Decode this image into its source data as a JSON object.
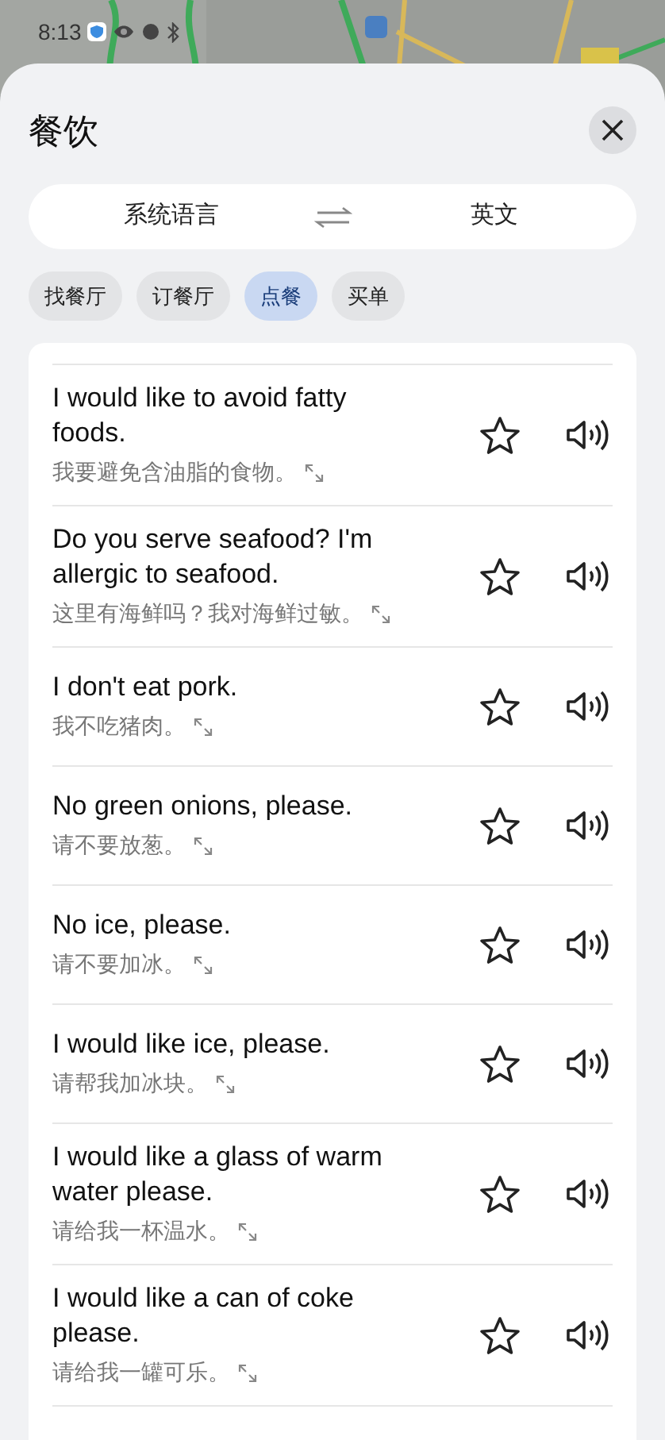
{
  "status_bar": {
    "time": "8:13"
  },
  "sheet": {
    "title": "餐饮"
  },
  "language_switch": {
    "source": "系统语言",
    "target": "英文"
  },
  "tabs": [
    {
      "label": "找餐厅",
      "selected": false
    },
    {
      "label": "订餐厅",
      "selected": false
    },
    {
      "label": "点餐",
      "selected": true
    },
    {
      "label": "买单",
      "selected": false
    }
  ],
  "phrases": [
    {
      "english": "I would like to avoid fatty foods.",
      "chinese": "我要避免含油脂的食物。",
      "favorite": false
    },
    {
      "english": "Do you serve seafood? I'm allergic to seafood.",
      "chinese": "这里有海鲜吗？我对海鲜过敏。",
      "favorite": false
    },
    {
      "english": "I don't eat pork.",
      "chinese": "我不吃猪肉。",
      "favorite": false
    },
    {
      "english": "No green onions, please.",
      "chinese": "请不要放葱。",
      "favorite": false
    },
    {
      "english": "No ice, please.",
      "chinese": "请不要加冰。",
      "favorite": false
    },
    {
      "english": "I would like ice, please.",
      "chinese": "请帮我加冰块。",
      "favorite": false
    },
    {
      "english": "I would like a glass of warm water please.",
      "chinese": "请给我一杯温水。",
      "favorite": false
    },
    {
      "english": "I would like a can of coke please.",
      "chinese": "请给我一罐可乐。",
      "favorite": false
    }
  ]
}
